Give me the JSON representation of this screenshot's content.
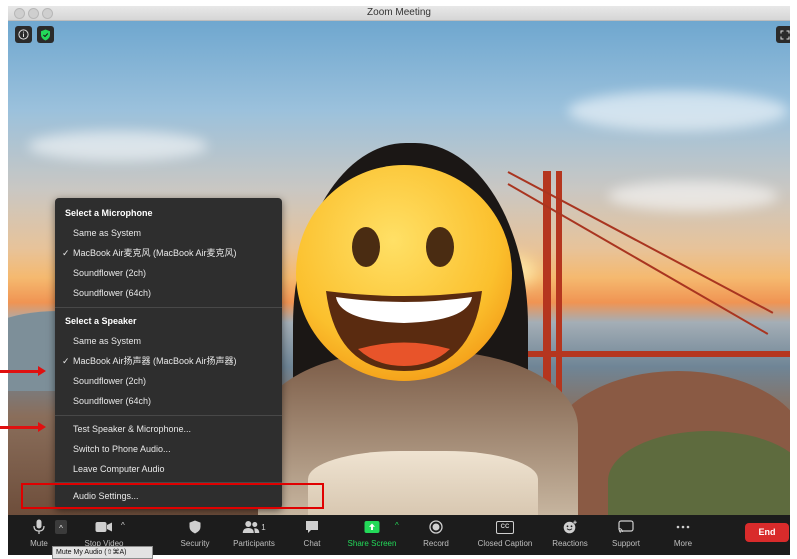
{
  "window": {
    "title": "Zoom Meeting"
  },
  "audio_menu": {
    "microphone": {
      "heading": "Select a Microphone",
      "items": [
        {
          "label": "Same as System",
          "checked": false
        },
        {
          "label": "MacBook Air麦克风 (MacBook Air麦克风)",
          "checked": true
        },
        {
          "label": "Soundflower (2ch)",
          "checked": false
        },
        {
          "label": "Soundflower (64ch)",
          "checked": false
        }
      ]
    },
    "speaker": {
      "heading": "Select a Speaker",
      "items": [
        {
          "label": "Same as System",
          "checked": false
        },
        {
          "label": "MacBook Air扬声器 (MacBook Air扬声器)",
          "checked": true
        },
        {
          "label": "Soundflower (2ch)",
          "checked": false
        },
        {
          "label": "Soundflower (64ch)",
          "checked": false
        }
      ]
    },
    "check_mark": "✓",
    "actions": [
      "Test Speaker & Microphone...",
      "Switch to Phone Audio...",
      "Leave Computer Audio"
    ],
    "settings": "Audio Settings..."
  },
  "toolbar": {
    "mute": "Mute",
    "stop_video": "Stop Video",
    "security": "Security",
    "participants": "Participants",
    "participant_count": "1",
    "chat": "Chat",
    "share_screen": "Share Screen",
    "record": "Record",
    "closed_caption": "Closed Caption",
    "cc_badge": "CC",
    "reactions": "Reactions",
    "support": "Support",
    "more": "More",
    "end": "End",
    "tooltip": "Mute My Audio (⇧⌘A)"
  },
  "colors": {
    "accent_green": "#23d959",
    "end_red": "#d92b2b",
    "annotation_red": "#e00000",
    "menu_bg": "#2e2e2e",
    "toolbar_bg": "#1c1c1c"
  }
}
